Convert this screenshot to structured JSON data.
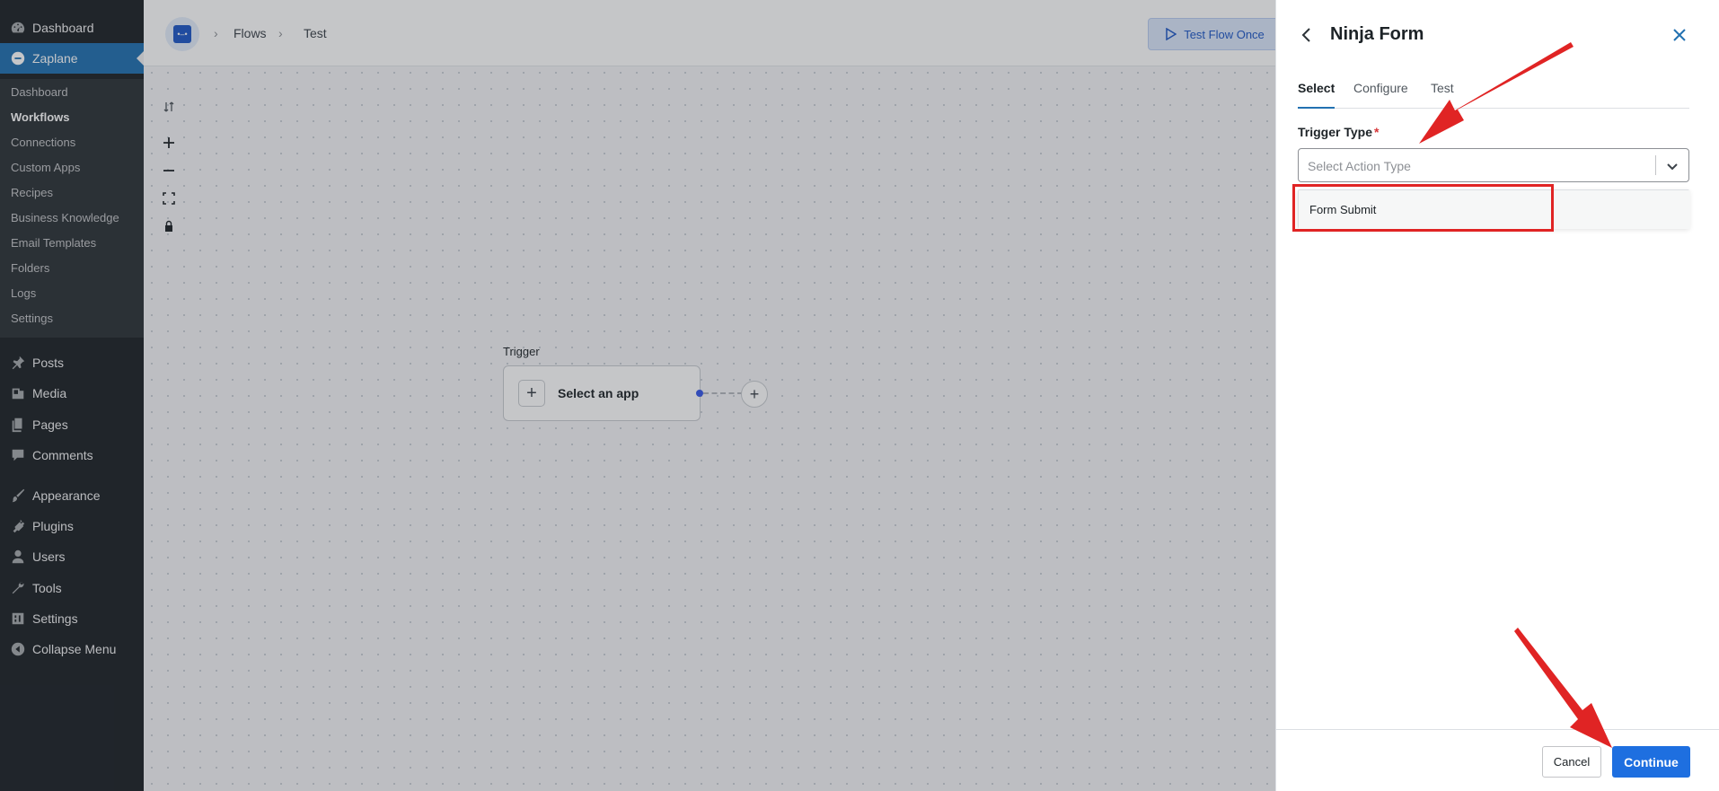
{
  "sidebar": {
    "top_items": [
      {
        "label": "Dashboard",
        "icon": "dashboard-icon"
      },
      {
        "label": "Zaplane",
        "icon": "zaplane-icon"
      }
    ],
    "submenu": [
      "Dashboard",
      "Workflows",
      "Connections",
      "Custom Apps",
      "Recipes",
      "Business Knowledge",
      "Email Templates",
      "Folders",
      "Logs",
      "Settings"
    ],
    "current_submenu": "Workflows",
    "bottom_items": [
      {
        "label": "Posts",
        "icon": "pin-icon"
      },
      {
        "label": "Media",
        "icon": "media-icon"
      },
      {
        "label": "Pages",
        "icon": "pages-icon"
      },
      {
        "label": "Comments",
        "icon": "comment-icon"
      },
      {
        "label": "Appearance",
        "icon": "brush-icon"
      },
      {
        "label": "Plugins",
        "icon": "plugin-icon"
      },
      {
        "label": "Users",
        "icon": "user-icon"
      },
      {
        "label": "Tools",
        "icon": "wrench-icon"
      },
      {
        "label": "Settings",
        "icon": "settings-icon"
      },
      {
        "label": "Collapse Menu",
        "icon": "collapse-icon"
      }
    ]
  },
  "topbar": {
    "breadcrumb": [
      "Flows",
      "Test"
    ],
    "test_flow_label": "Test Flow Once"
  },
  "canvas": {
    "trigger_label": "Trigger",
    "node_label": "Select an app"
  },
  "panel": {
    "title": "Ninja Form",
    "tabs": [
      "Select",
      "Configure",
      "Test"
    ],
    "active_tab": "Select",
    "field_label": "Trigger Type",
    "required_mark": "*",
    "placeholder": "Select Action Type",
    "options": [
      "Form Submit"
    ],
    "cancel_label": "Cancel",
    "continue_label": "Continue"
  },
  "colors": {
    "sidebar_bg": "#1d2327",
    "accent": "#2271b1",
    "primary_button": "#1e6fe0",
    "annotation_red": "#e02424"
  }
}
